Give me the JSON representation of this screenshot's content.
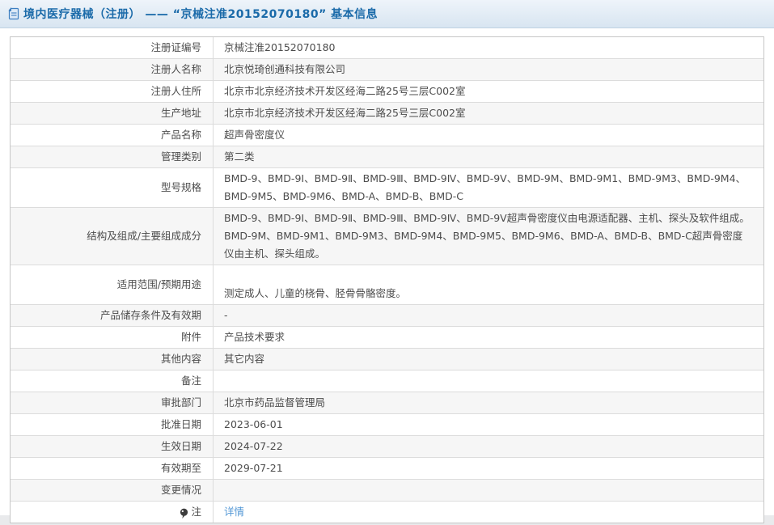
{
  "colors": {
    "accent_blue": "#1a6aa9",
    "link_blue": "#5297d5",
    "row_alt_bg": "#f6f6f6",
    "table_border": "#c6c6c6"
  },
  "header": {
    "icon": "document-icon",
    "title_prefix": "境内医疗器械（注册） —— ",
    "title_quoted": "“京械注准20152070180”",
    "title_suffix": " 基本信息"
  },
  "table": {
    "rows": [
      {
        "label": "注册证编号",
        "value": "京械注准20152070180"
      },
      {
        "label": "注册人名称",
        "value": "北京悦琦创通科技有限公司"
      },
      {
        "label": "注册人住所",
        "value": "北京市北京经济技术开发区经海二路25号三层C002室"
      },
      {
        "label": "生产地址",
        "value": "北京市北京经济技术开发区经海二路25号三层C002室"
      },
      {
        "label": "产品名称",
        "value": "超声骨密度仪"
      },
      {
        "label": "管理类别",
        "value": "第二类"
      },
      {
        "label": "型号规格",
        "value": "BMD-9、BMD-9Ⅰ、BMD-9Ⅱ、BMD-9Ⅲ、BMD-9Ⅳ、BMD-9Ⅴ、BMD-9M、BMD-9M1、BMD-9M3、BMD-9M4、BMD-9M5、BMD-9M6、BMD-A、BMD-B、BMD-C"
      },
      {
        "label": "结构及组成/主要组成成分",
        "value": "BMD-9、BMD-9Ⅰ、BMD-9Ⅱ、BMD-9Ⅲ、BMD-9Ⅳ、BMD-9Ⅴ超声骨密度仪由电源适配器、主机、探头及软件组成。BMD-9M、BMD-9M1、BMD-9M3、BMD-9M4、BMD-9M5、BMD-9M6、BMD-A、BMD-B、BMD-C超声骨密度仪由主机、探头组成。"
      },
      {
        "label": "适用范围/预期用途",
        "value": "\n测定成人、儿童的桡骨、胫骨骨骼密度。"
      },
      {
        "label": "产品储存条件及有效期",
        "value": "-"
      },
      {
        "label": "附件",
        "value": "产品技术要求"
      },
      {
        "label": "其他内容",
        "value": "其它内容"
      },
      {
        "label": "备注",
        "value": ""
      },
      {
        "label": "审批部门",
        "value": "北京市药品监督管理局"
      },
      {
        "label": "批准日期",
        "value": "2023-06-01"
      },
      {
        "label": "生效日期",
        "value": "2024-07-22"
      },
      {
        "label": "有效期至",
        "value": "2029-07-21"
      },
      {
        "label": "变更情况",
        "value": ""
      },
      {
        "label": "注",
        "label_icon": "note-icon",
        "value": "详情",
        "value_is_link": true
      }
    ]
  }
}
